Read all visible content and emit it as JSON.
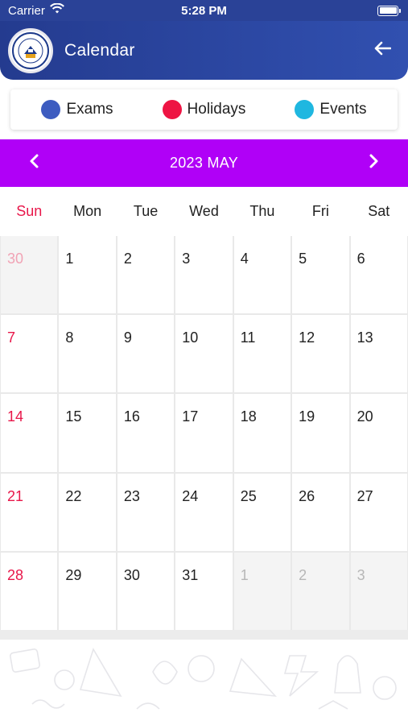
{
  "status_bar": {
    "carrier": "Carrier",
    "time": "5:28 PM"
  },
  "header": {
    "title": "Calendar"
  },
  "legend": [
    {
      "label": "Exams",
      "color": "#3d5cc0"
    },
    {
      "label": "Holidays",
      "color": "#ee1443"
    },
    {
      "label": "Events",
      "color": "#1fb7e0"
    }
  ],
  "month_nav": {
    "label": "2023 MAY"
  },
  "weekdays": [
    "Sun",
    "Mon",
    "Tue",
    "Wed",
    "Thu",
    "Fri",
    "Sat"
  ],
  "weeks": [
    [
      {
        "day": "30",
        "outside": true
      },
      {
        "day": "1"
      },
      {
        "day": "2"
      },
      {
        "day": "3"
      },
      {
        "day": "4"
      },
      {
        "day": "5"
      },
      {
        "day": "6"
      }
    ],
    [
      {
        "day": "7"
      },
      {
        "day": "8"
      },
      {
        "day": "9"
      },
      {
        "day": "10"
      },
      {
        "day": "11"
      },
      {
        "day": "12"
      },
      {
        "day": "13"
      }
    ],
    [
      {
        "day": "14"
      },
      {
        "day": "15"
      },
      {
        "day": "16"
      },
      {
        "day": "17"
      },
      {
        "day": "18"
      },
      {
        "day": "19"
      },
      {
        "day": "20"
      }
    ],
    [
      {
        "day": "21"
      },
      {
        "day": "22"
      },
      {
        "day": "23"
      },
      {
        "day": "24"
      },
      {
        "day": "25"
      },
      {
        "day": "26"
      },
      {
        "day": "27"
      }
    ],
    [
      {
        "day": "28"
      },
      {
        "day": "29"
      },
      {
        "day": "30"
      },
      {
        "day": "31"
      },
      {
        "day": "1",
        "outside": true
      },
      {
        "day": "2",
        "outside": true
      },
      {
        "day": "3",
        "outside": true
      }
    ]
  ],
  "colors": {
    "header_bg": "#2a4297",
    "month_bar_bg": "#b000f7",
    "sunday_text": "#e8174a",
    "outside_text": "#b7b7b7"
  },
  "icons": {
    "wifi": "wifi-icon",
    "battery": "battery-icon",
    "logo": "school-logo",
    "back": "arrow-left-icon",
    "prev": "chevron-left-icon",
    "next": "chevron-right-icon"
  }
}
